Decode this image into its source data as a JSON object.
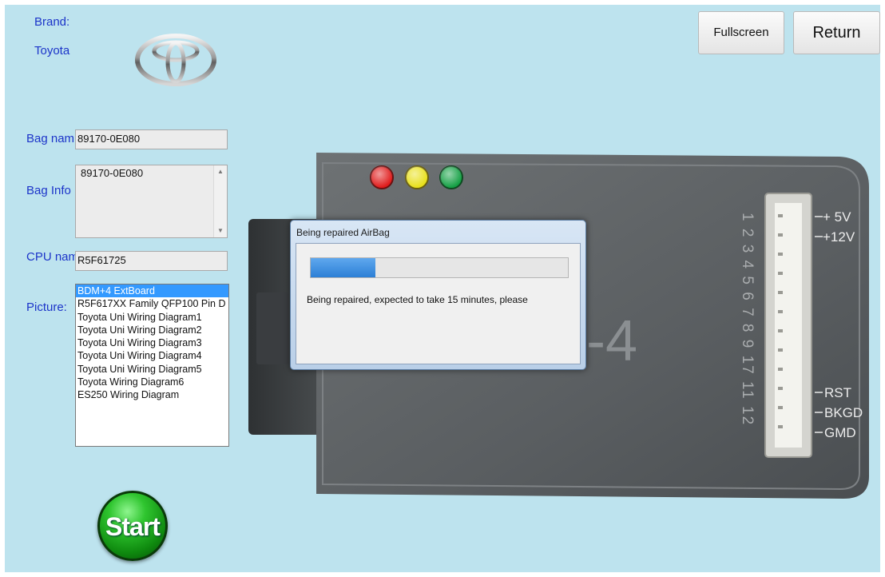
{
  "brand": {
    "label": "Brand:",
    "value": "Toyota",
    "logo_icon": "toyota-logo-icon"
  },
  "bag_name": {
    "label": "Bag nam",
    "value": "89170-0E080"
  },
  "bag_info": {
    "label": "Bag Info",
    "value": "89170-0E080"
  },
  "cpu_name": {
    "label": "CPU nam",
    "value": "R5F61725"
  },
  "picture": {
    "label": "Picture:",
    "items": [
      "BDM+4 ExtBoard",
      "R5F617XX Family QFP100 Pin D",
      "Toyota Uni Wiring Diagram1",
      "Toyota Uni Wiring Diagram2",
      "Toyota Uni Wiring Diagram3",
      "Toyota Uni Wiring Diagram4",
      "Toyota Uni Wiring Diagram5",
      "Toyota Wiring Diagram6",
      "ES250 Wiring Diagram"
    ],
    "selected_index": 0
  },
  "buttons": {
    "fullscreen": "Fullscreen",
    "return": "Return",
    "start": "Start"
  },
  "device": {
    "pin_numbers": "1 2 3 4 5 6 7 8 9 17 11 12",
    "power_labels": [
      "+ 5V",
      "+12V"
    ],
    "signal_labels": [
      "RST",
      "BKGD",
      "GMD"
    ],
    "body_text": "-4",
    "led_colors": [
      "#e01b1b",
      "#e8e01a",
      "#14a044"
    ]
  },
  "dialog": {
    "title": "Being repaired AirBag",
    "message": "Being repaired, expected to take 15 minutes, please",
    "progress": 0.25
  },
  "colors": {
    "background": "#bde3ee",
    "label": "#1d35c9",
    "selection": "#3399ff"
  }
}
